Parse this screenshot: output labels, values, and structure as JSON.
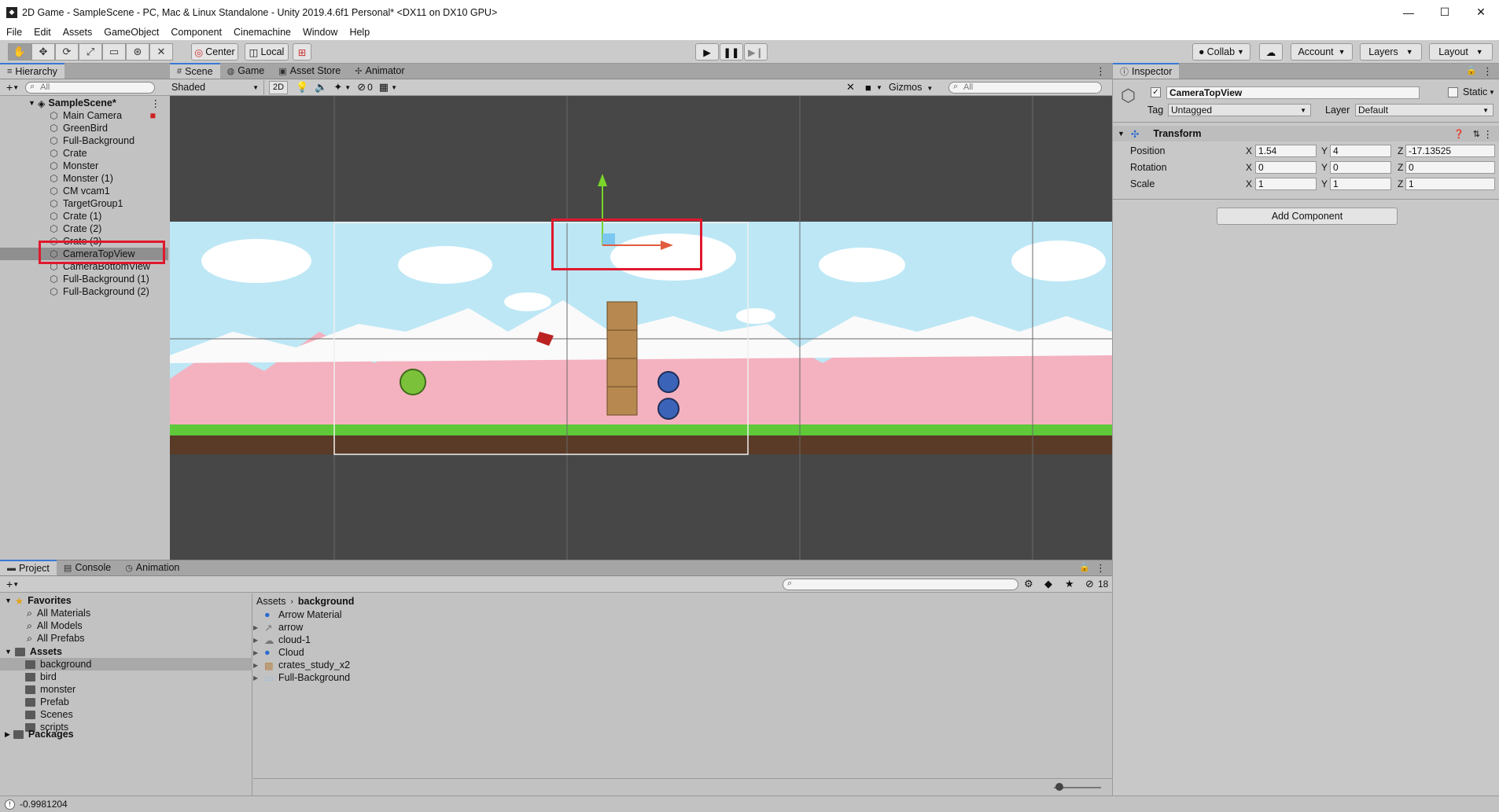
{
  "window": {
    "title": "2D Game - SampleScene - PC, Mac & Linux Standalone - Unity 2019.4.6f1 Personal* <DX11 on DX10 GPU>",
    "min": "—",
    "max": "☐",
    "close": "✕"
  },
  "menu": [
    "File",
    "Edit",
    "Assets",
    "GameObject",
    "Component",
    "Cinemachine",
    "Window",
    "Help"
  ],
  "toolbar": {
    "center": "Center",
    "local": "Local",
    "collab": "Collab",
    "account": "Account",
    "layers": "Layers",
    "layout": "Layout"
  },
  "hierarchy": {
    "tab": "Hierarchy",
    "search_placeholder": "All",
    "scene": "SampleScene*",
    "items": [
      "Main Camera",
      "GreenBird",
      "Full-Background",
      "Crate",
      "Monster",
      "Monster (1)",
      "CM vcam1",
      "TargetGroup1",
      "Crate (1)",
      "Crate (2)",
      "Crate (3)",
      "CameraTopView",
      "CameraBottomView",
      "Full-Background (1)",
      "Full-Background (2)"
    ],
    "selected": "CameraTopView"
  },
  "scene": {
    "tabs": [
      "Scene",
      "Game",
      "Asset Store",
      "Animator"
    ],
    "shading": "Shaded",
    "mode2d": "2D",
    "hidden_count": "0",
    "gizmos": "Gizmos",
    "search_placeholder": "All"
  },
  "inspector": {
    "tab": "Inspector",
    "object_name": "CameraTopView",
    "static_label": "Static",
    "tag_label": "Tag",
    "tag_value": "Untagged",
    "layer_label": "Layer",
    "layer_value": "Default",
    "component": "Transform",
    "rows": [
      {
        "label": "Position",
        "x": "1.54",
        "y": "4",
        "z": "-17.13525"
      },
      {
        "label": "Rotation",
        "x": "0",
        "y": "0",
        "z": "0"
      },
      {
        "label": "Scale",
        "x": "1",
        "y": "1",
        "z": "1"
      }
    ],
    "add_component": "Add Component"
  },
  "project": {
    "tabs": [
      "Project",
      "Console",
      "Animation"
    ],
    "hidden_count": "18",
    "favorites_label": "Favorites",
    "favorites": [
      "All Materials",
      "All Models",
      "All Prefabs"
    ],
    "assets_label": "Assets",
    "folders": [
      "background",
      "bird",
      "monster",
      "Prefab",
      "Scenes",
      "scripts"
    ],
    "packages_label": "Packages",
    "breadcrumb_root": "Assets",
    "breadcrumb_current": "background",
    "assets": [
      "Arrow Material",
      "arrow",
      "cloud-1",
      "Cloud",
      "crates_study_x2",
      "Full-Background"
    ]
  },
  "status": {
    "text": "-0.9981204"
  },
  "colors": {
    "accent": "#3a79d8",
    "highlight": "#e0182d",
    "selection": "#8f8f8f",
    "sky": "#bde7f5",
    "mountain": "#f4b1bf",
    "grass": "#5fc93a"
  }
}
